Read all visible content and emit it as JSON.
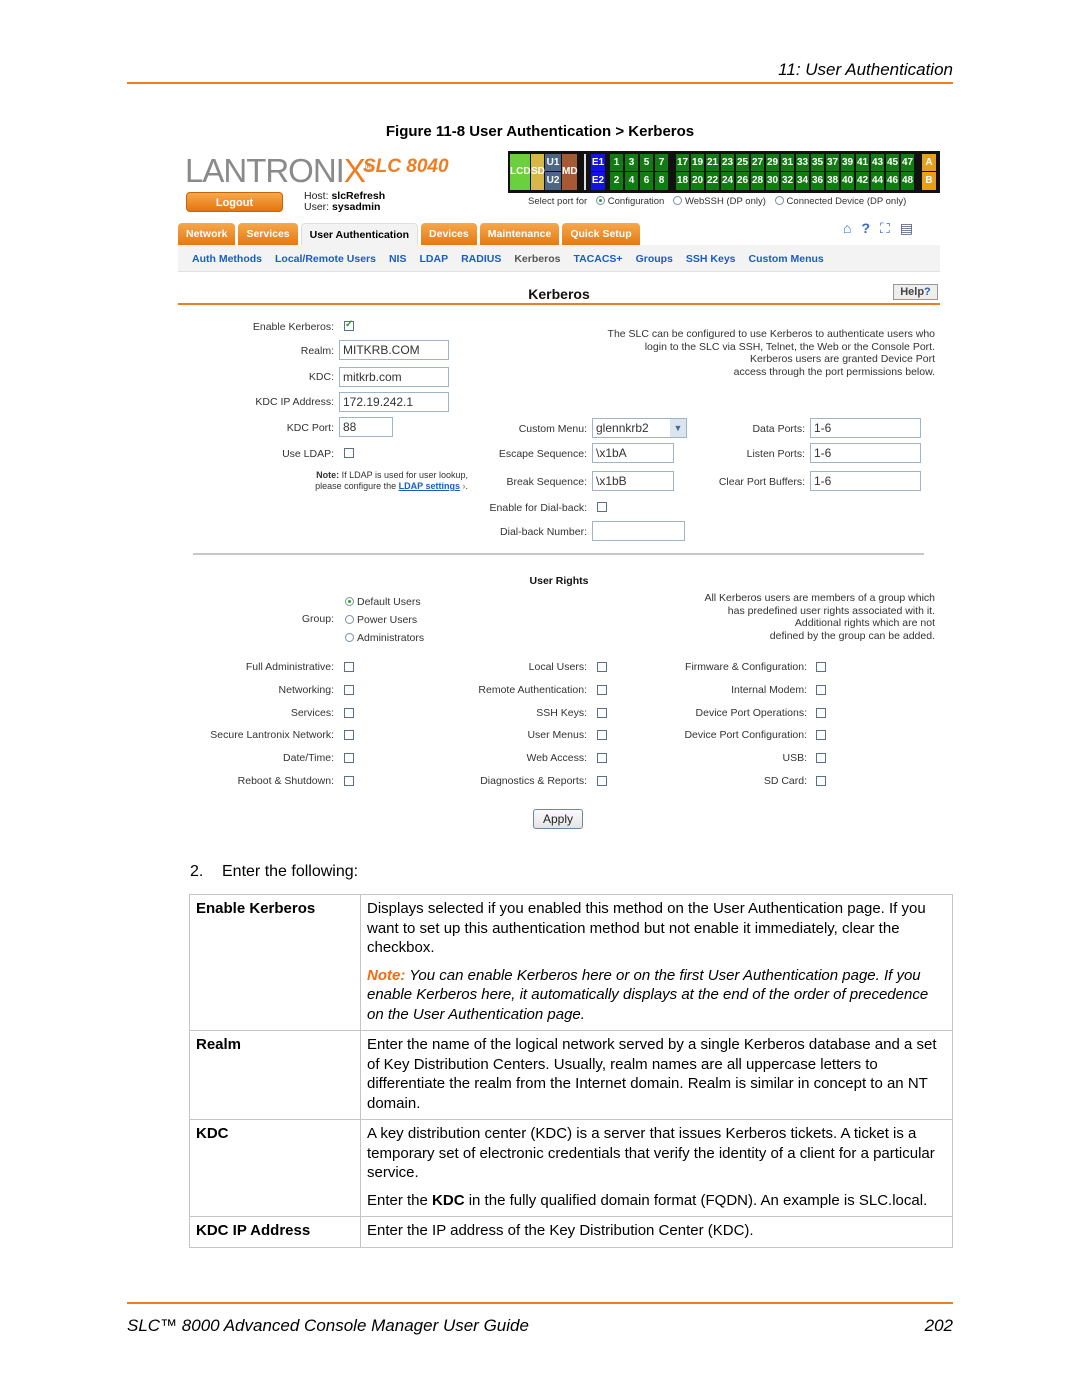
{
  "header": {
    "chapter": "11: User Authentication"
  },
  "figure": {
    "caption": "Figure 11-8  User Authentication > Kerberos"
  },
  "app": {
    "logo": "LANTRONIX",
    "product": "SLC 8040",
    "logout_label": "Logout",
    "host_label": "Host:",
    "host_value": "slcRefresh",
    "user_label": "User:",
    "user_value": "sysadmin",
    "portmap": {
      "modules": [
        "LCD",
        "SD",
        "U1",
        "U2",
        "MD"
      ],
      "ethernet": [
        "E1",
        "E2"
      ],
      "ports_top": [
        "1",
        "3",
        "5",
        "7",
        "17",
        "19",
        "21",
        "23",
        "25",
        "27",
        "29",
        "31",
        "33",
        "35",
        "37",
        "39",
        "41",
        "43",
        "45",
        "47"
      ],
      "ports_bottom": [
        "2",
        "4",
        "6",
        "8",
        "18",
        "20",
        "22",
        "24",
        "26",
        "28",
        "30",
        "32",
        "34",
        "36",
        "38",
        "40",
        "42",
        "44",
        "46",
        "48"
      ],
      "extra": [
        "A",
        "B"
      ],
      "colors": {
        "port": "#117c11",
        "lcd": "#6ccf3d",
        "sd": "#d7b64a",
        "usb": "#4d6684",
        "md": "#a55a35",
        "eth": "#1212e6",
        "ab": "#e5a11b"
      }
    },
    "select_port": {
      "label": "Select port for",
      "options": [
        "Configuration",
        "WebSSH (DP only)",
        "Connected Device (DP only)"
      ],
      "selected": "Configuration"
    },
    "tabs": [
      "Network",
      "Services",
      "User Authentication",
      "Devices",
      "Maintenance",
      "Quick Setup"
    ],
    "active_tab": "User Authentication",
    "tab_icons": [
      "home-icon",
      "help-icon",
      "sitemap-icon",
      "log-icon"
    ],
    "subnav": [
      "Auth Methods",
      "Local/Remote Users",
      "NIS",
      "LDAP",
      "RADIUS",
      "Kerberos",
      "TACACS+",
      "Groups",
      "SSH Keys",
      "Custom Menus"
    ],
    "active_subnav": "Kerberos",
    "page_title": "Kerberos",
    "help_label": "Help",
    "form": {
      "enable_kerberos_label": "Enable Kerberos:",
      "enable_kerberos": true,
      "realm_label": "Realm:",
      "realm": "MITKRB.COM",
      "kdc_label": "KDC:",
      "kdc": "mitkrb.com",
      "kdc_ip_label": "KDC IP Address:",
      "kdc_ip": "172.19.242.1",
      "kdc_port_label": "KDC Port:",
      "kdc_port": "88",
      "use_ldap_label": "Use LDAP:",
      "use_ldap": false,
      "ldap_note_bold": "Note:",
      "ldap_note_1": " If LDAP is used for user lookup,",
      "ldap_note_2": "please configure the ",
      "ldap_link": "LDAP settings",
      "info_text": [
        "The SLC can be configured to use Kerberos to authenticate users who",
        "login to the SLC via SSH, Telnet, the Web or the Console Port.",
        "Kerberos users are granted Device Port",
        "access through the port permissions below."
      ],
      "custom_menu_label": "Custom Menu:",
      "custom_menu": "glennkrb2",
      "escape_label": "Escape Sequence:",
      "escape": "\\x1bA",
      "break_label": "Break Sequence:",
      "break": "\\x1bB",
      "dialback_label": "Enable for Dial-back:",
      "dialback": false,
      "dialback_number_label": "Dial-back Number:",
      "dialback_number": "",
      "data_ports_label": "Data Ports:",
      "data_ports": "1-6",
      "listen_ports_label": "Listen Ports:",
      "listen_ports": "1-6",
      "clear_buffers_label": "Clear Port Buffers:",
      "clear_buffers": "1-6"
    },
    "user_rights": {
      "title": "User Rights",
      "group_label": "Group:",
      "groups": [
        "Default Users",
        "Power Users",
        "Administrators"
      ],
      "selected_group": "Default Users",
      "info_text": [
        "All Kerberos users are members of a group which",
        "has predefined user rights associated with it.",
        "Additional rights which are not",
        "defined by the group can be added."
      ],
      "col1": [
        "Full Administrative:",
        "Networking:",
        "Services:",
        "Secure Lantronix Network:",
        "Date/Time:",
        "Reboot & Shutdown:"
      ],
      "col2": [
        "Local Users:",
        "Remote Authentication:",
        "SSH Keys:",
        "User Menus:",
        "Web Access:",
        "Diagnostics & Reports:"
      ],
      "col3": [
        "Firmware & Configuration:",
        "Internal Modem:",
        "Device Port Operations:",
        "Device Port Configuration:",
        "USB:",
        "SD Card:"
      ]
    },
    "apply_label": "Apply"
  },
  "doc": {
    "step_num": "2.",
    "step_text": "Enter the following:",
    "rows": [
      {
        "key": "Enable Kerberos",
        "text": "Displays selected if you enabled this method on the User Authentication page. If you want to set up this authentication method but not enable it immediately, clear the checkbox.",
        "note_label": "Note:",
        "note": "  You can enable Kerberos here or on the first User Authentication page. If you enable Kerberos here, it automatically displays at the end of the order of precedence on the User Authentication page."
      },
      {
        "key": "Realm",
        "text": "Enter the name of the logical network served by a single Kerberos database and a set of Key Distribution Centers. Usually, realm names are all uppercase letters to differentiate the realm from the Internet domain. Realm is similar in concept to an NT domain."
      },
      {
        "key": "KDC",
        "text": "A key distribution center (KDC) is a server that issues Kerberos tickets. A ticket is a temporary set of electronic credentials that verify the identity of a client for a particular service.",
        "text2_pre": "Enter the ",
        "text2_bold": "KDC",
        "text2_post": " in the fully qualified domain format (FQDN). An example is SLC.local."
      },
      {
        "key": "KDC IP Address",
        "text": "Enter the IP address of the Key Distribution Center (KDC)."
      }
    ]
  },
  "footer": {
    "title": "SLC™ 8000 Advanced Console Manager User Guide",
    "page": "202"
  }
}
